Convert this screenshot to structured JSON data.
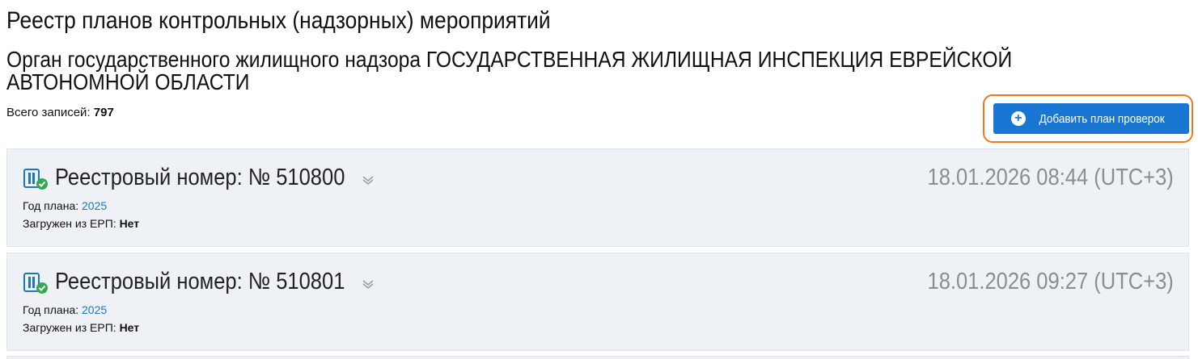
{
  "page": {
    "title": "Реестр планов контрольных (надзорных) мероприятий",
    "org_title": "Орган государственного жилищного надзора ГОСУДАРСТВЕННАЯ ЖИЛИЩНАЯ ИНСПЕКЦИЯ ЕВРЕЙСКОЙ АВТОНОМНОЙ ОБЛАСТИ",
    "count_label": "Всего записей:",
    "count_value": "797"
  },
  "toolbar": {
    "add_label": "Добавить план проверок",
    "add_icon": "plus-circle-icon"
  },
  "colors": {
    "accent": "#1976d2",
    "highlight": "#ec7a1c",
    "card_bg": "#eef2f6",
    "link": "#1f76b8",
    "status_ok": "#34a853"
  },
  "records": [
    {
      "title": "Реестровый номер: № 510800",
      "date": "18.01.2026 08:44 (UTC+3)",
      "year_label": "Год плана:",
      "year_value": "2025",
      "erp_label": "Загружен из ЕРП:",
      "erp_value": "Нет"
    },
    {
      "title": "Реестровый номер: № 510801",
      "date": "18.01.2026 09:27 (UTC+3)",
      "year_label": "Год плана:",
      "year_value": "2025",
      "erp_label": "Загружен из ЕРП:",
      "erp_value": "Нет"
    }
  ]
}
